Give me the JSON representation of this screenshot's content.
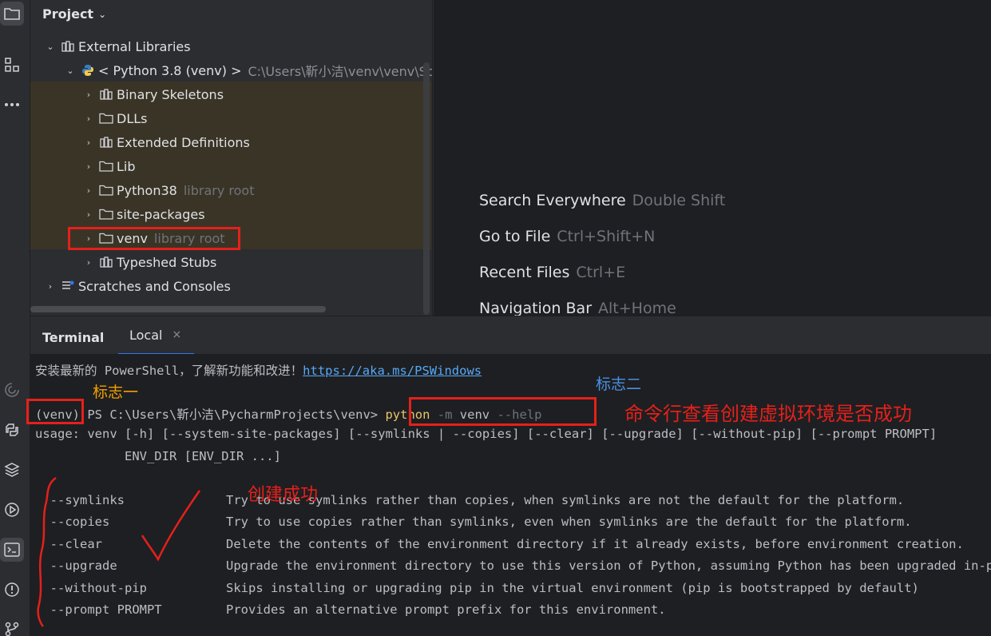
{
  "project": {
    "title": "Project",
    "tree": [
      {
        "label": "External Libraries",
        "hint": ""
      },
      {
        "label": "< Python 3.8 (venv) >",
        "path": "C:\\Users\\靳小洁\\venv\\venv\\Scr"
      },
      {
        "label": "Binary Skeletons",
        "hint": ""
      },
      {
        "label": "DLLs",
        "hint": ""
      },
      {
        "label": "Extended Definitions",
        "hint": ""
      },
      {
        "label": "Lib",
        "hint": ""
      },
      {
        "label": "Python38",
        "hint": "library root"
      },
      {
        "label": "site-packages",
        "hint": ""
      },
      {
        "label": "venv",
        "hint": "library root"
      },
      {
        "label": "Typeshed Stubs",
        "hint": ""
      },
      {
        "label": "Scratches and Consoles",
        "hint": ""
      }
    ]
  },
  "welcome": {
    "actions": [
      {
        "label": "Search Everywhere",
        "shortcut": "Double Shift"
      },
      {
        "label": "Go to File",
        "shortcut": "Ctrl+Shift+N"
      },
      {
        "label": "Recent Files",
        "shortcut": "Ctrl+E"
      },
      {
        "label": "Navigation Bar",
        "shortcut": "Alt+Home"
      }
    ]
  },
  "terminal": {
    "title": "Terminal",
    "tab": "Local",
    "tab_close": "×",
    "install_msg": "安装最新的 PowerShell，了解新功能和改进！",
    "install_link": "https://aka.ms/PSWindows",
    "venv_prefix": "(venv)",
    "ps_path": " PS C:\\Users\\靳小洁\\PycharmProjects\\venv> ",
    "cmd_python": "python",
    "cmd_m": " -m",
    "cmd_venv": " venv",
    "cmd_help": " --help",
    "usage1": "usage: venv [-h] [--system-site-packages] [--symlinks | --copies] [--clear] [--upgrade] [--without-pip] [--prompt PROMPT]",
    "usage2": "            ENV_DIR [ENV_DIR ...]",
    "options": [
      {
        "flag": "  --symlinks",
        "desc": "Try to use symlinks rather than copies, when symlinks are not the default for the platform."
      },
      {
        "flag": "  --copies",
        "desc": "Try to use copies rather than symlinks, even when symlinks are the default for the platform."
      },
      {
        "flag": "  --clear",
        "desc": "Delete the contents of the environment directory if it already exists, before environment creation."
      },
      {
        "flag": "  --upgrade",
        "desc": "Upgrade the environment directory to use this version of Python, assuming Python has been upgraded in-place."
      },
      {
        "flag": "  --without-pip",
        "desc": "Skips installing or upgrading pip in the virtual environment (pip is bootstrapped by default)"
      },
      {
        "flag": "  --prompt PROMPT",
        "desc": "Provides an alternative prompt prefix for this environment."
      }
    ]
  },
  "annotations": {
    "mark1": "标志一",
    "mark2": "标志二",
    "check_cmd": "命令行查看创建虚拟环境是否成功",
    "success": "创建成功"
  },
  "colors": {
    "annotation_red": "#e5201b",
    "mark1_orange": "#f0a000",
    "mark2_blue": "#4a90e2"
  }
}
